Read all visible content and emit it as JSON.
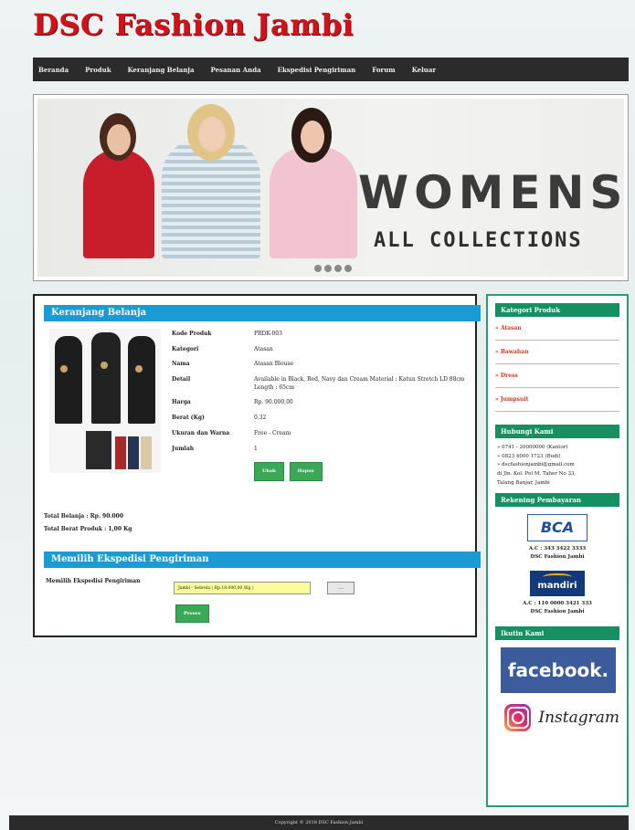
{
  "site": {
    "title": "DSC Fashion Jambi"
  },
  "nav": {
    "items": [
      "Beranda",
      "Produk",
      "Keranjang Belanja",
      "Pesanan Anda",
      "Ekspedisi Pengiriman",
      "Forum",
      "Keluar"
    ]
  },
  "banner": {
    "headline": "WOMENS",
    "subline": "ALL COLLECTIONS"
  },
  "cart": {
    "title": "Keranjang Belanja",
    "rows": [
      {
        "label": "Kode Produk",
        "value": "PRDK-003"
      },
      {
        "label": "Kategori",
        "value": "Atasan"
      },
      {
        "label": "Nama",
        "value": "Atasan Blouse"
      },
      {
        "label": "Detail",
        "value": "Available in Black, Red, Navy dan Cream Material : Katun Stretch LD 88cm Length : 65cm"
      },
      {
        "label": "Harga",
        "value": "Rp. 90.000,00"
      },
      {
        "label": "Berat (Kg)",
        "value": "0.32"
      },
      {
        "label": "Ukuran dan Warna",
        "value": "Free - Cream"
      },
      {
        "label": "Jumlah",
        "value": "1"
      }
    ],
    "edit_label": "Ubah",
    "delete_label": "Hapus",
    "total_label": "Total Belanja : Rp. 90.000",
    "weight_label": "Total Berat Produk : 1,00 Kg"
  },
  "shipping": {
    "title": "Memilih Ekspedisi Pengiriman",
    "field_label": "Memilih Ekspedisi Pengiriman",
    "selected": "Jambi - Sebrela ( Rp.18.000,00 /Kg )",
    "browse_label": "....",
    "submit_label": "Proses"
  },
  "sidebar": {
    "categories_title": "Kategori Produk",
    "categories": [
      "» Atasan",
      "» Bawahan",
      "» Dress",
      "» Jumpsuit"
    ],
    "contact_title": "Hubungi Kami",
    "contact_lines": [
      "» 0741 - 20000000 (Kantor)",
      "» 0823 4000 1723 (Budi)",
      "» dscfashionjambi@gmail.com",
      "di Jln. Kol. Pol M. Taher No 33,",
      "Talang Banjar, Jambi"
    ],
    "payment_title": "Rekening Pembayaran",
    "bank1_logo": "BCA",
    "bank1_account": "A.C : 343 3422 3333",
    "bank1_name": "DSC Fashion Jambi",
    "bank2_logo": "mandiri",
    "bank2_account": "A.C : 110 0000 3421 333",
    "bank2_name": "DSC Fashion Jambi",
    "follow_title": "Ikutin Kami",
    "facebook": "facebook.",
    "instagram": "Instagram"
  },
  "footer": {
    "text": "Copyright © 2018 DSC Fashion Jambi"
  },
  "colors": {
    "accent_blue": "#1a9bd4",
    "accent_green": "#169061",
    "logo_red": "#d0131b",
    "button_green": "#3aa957"
  }
}
